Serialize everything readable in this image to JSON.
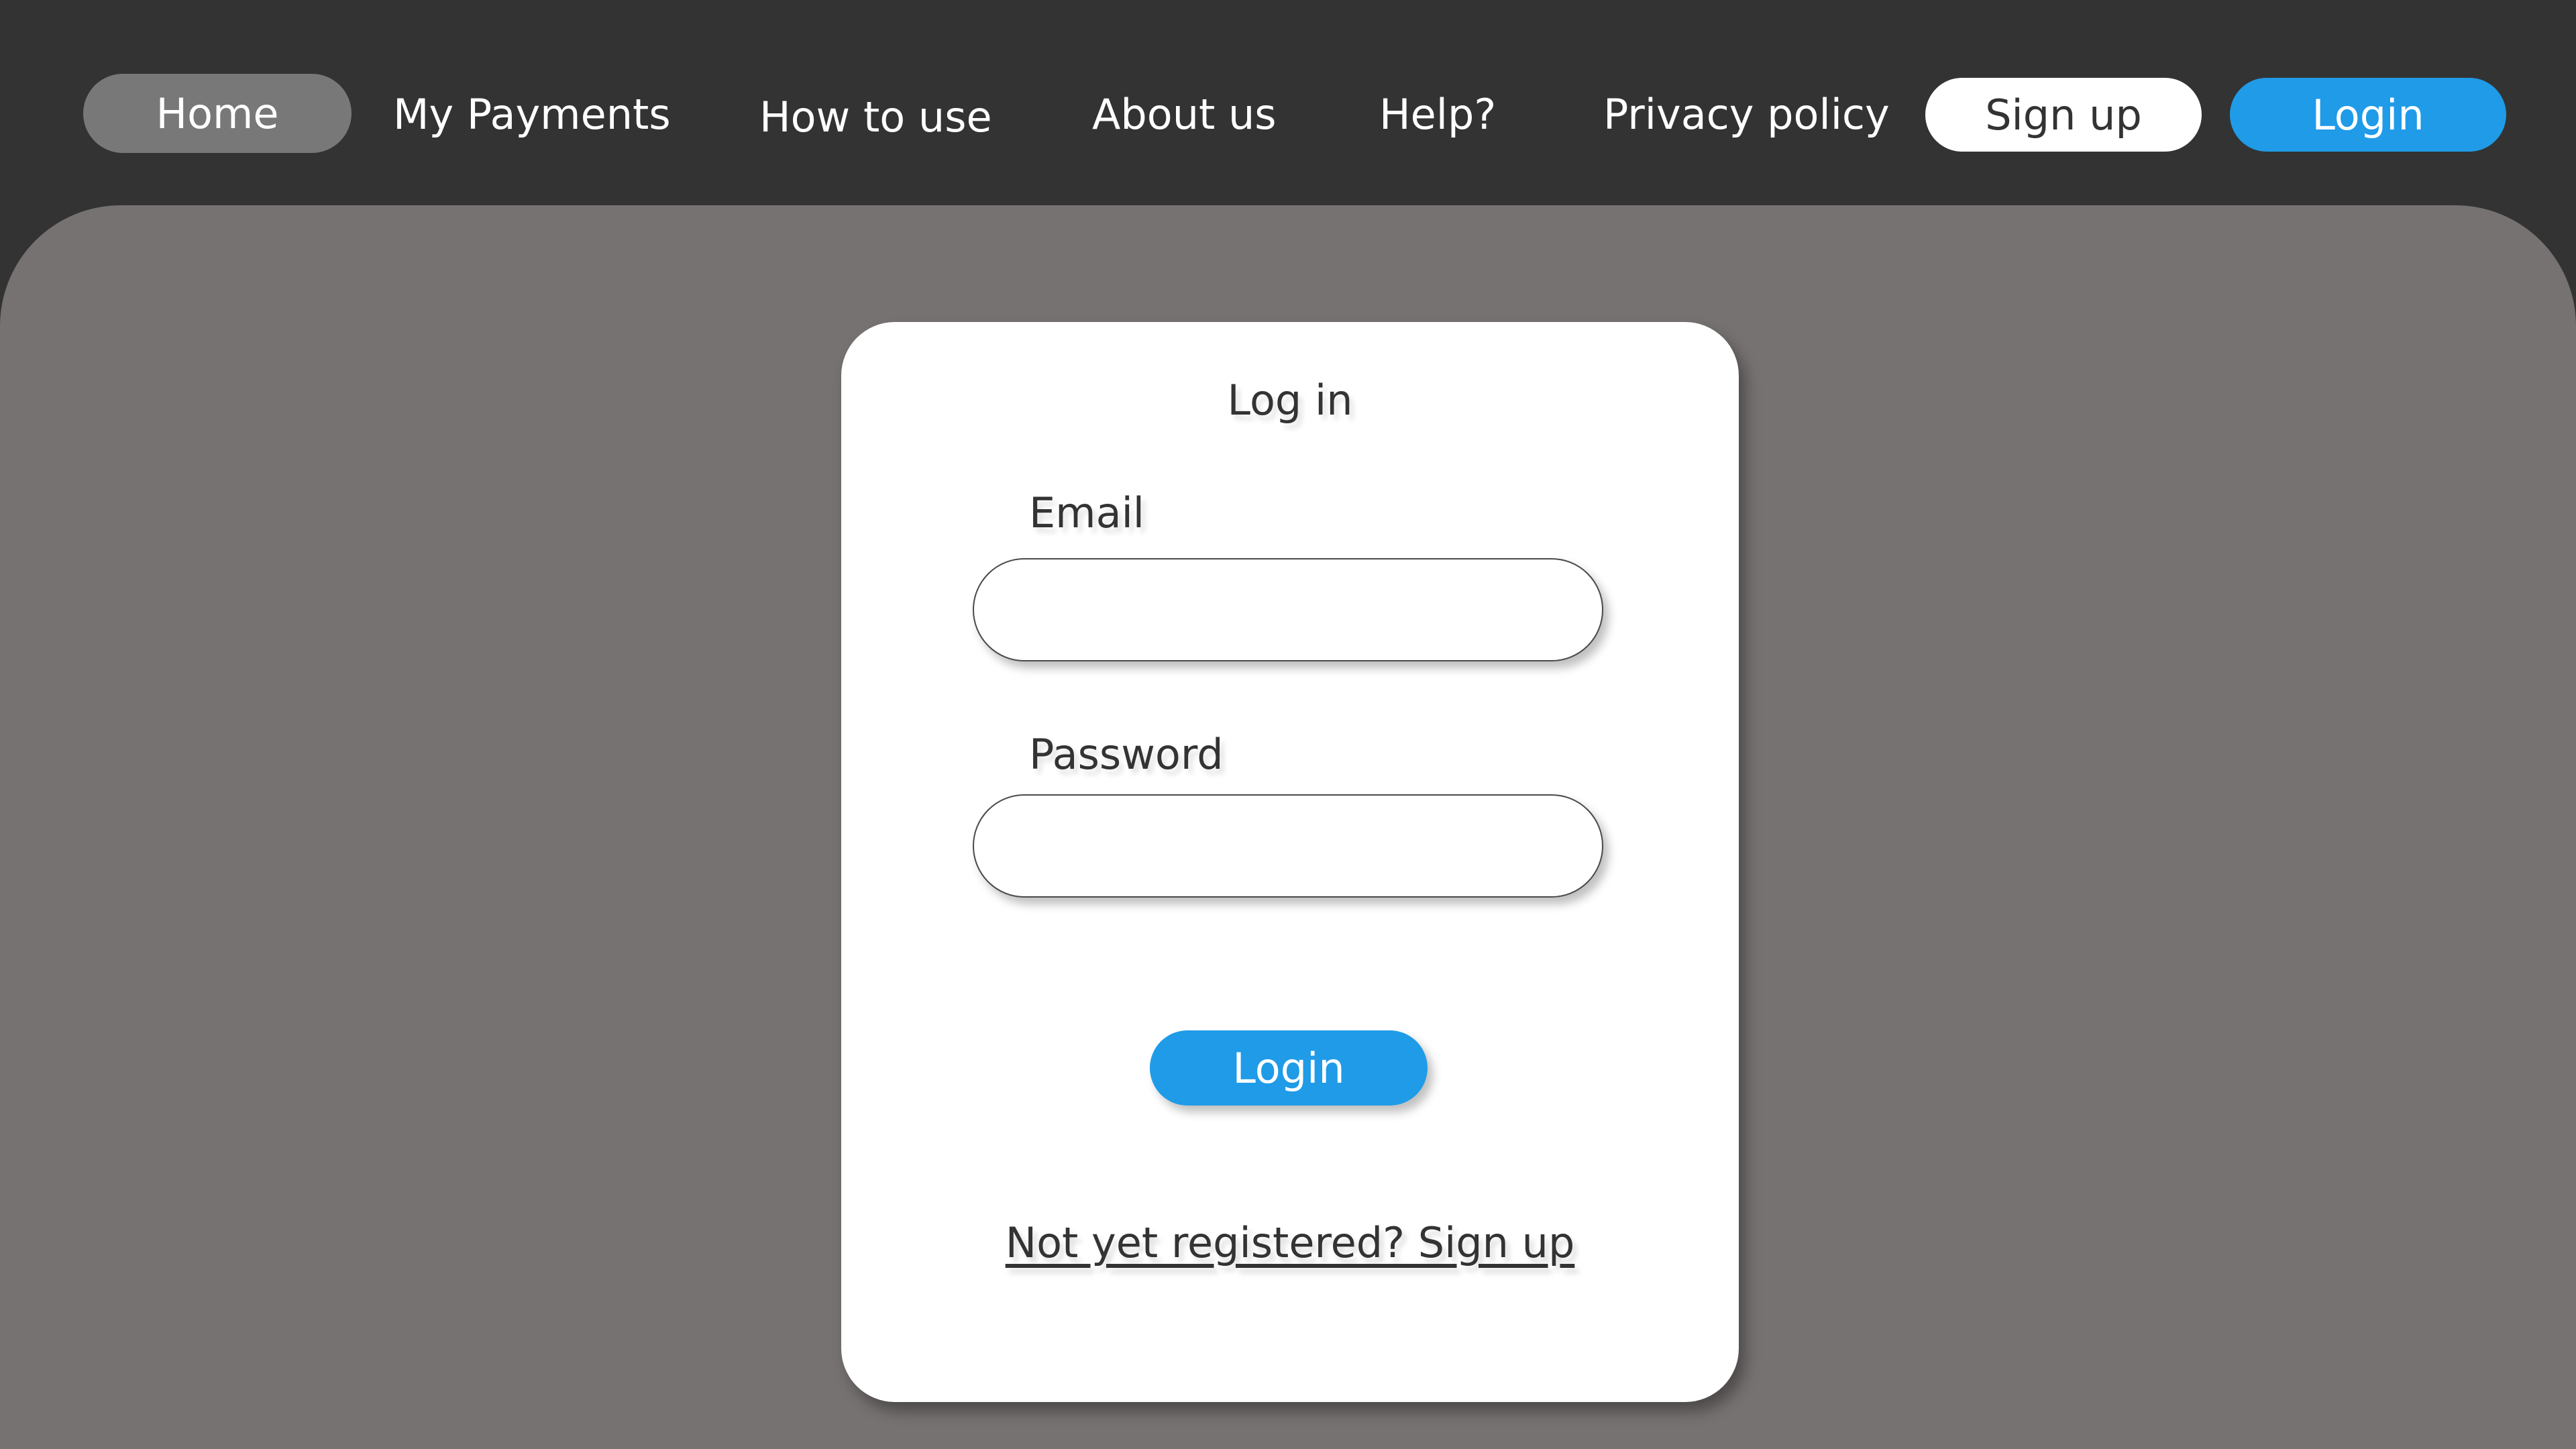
{
  "nav": {
    "home": "Home",
    "items": [
      {
        "label": "My Payments"
      },
      {
        "label": "How to use"
      },
      {
        "label": "About us"
      },
      {
        "label": "Help?"
      },
      {
        "label": "Privacy policy"
      }
    ],
    "signup_label": "Sign up",
    "login_label": "Login"
  },
  "login_card": {
    "title": "Log in",
    "email_label": "Email",
    "email_value": "",
    "password_label": "Password",
    "password_value": "",
    "submit_label": "Login",
    "signup_prompt": "Not yet registered? Sign up"
  },
  "colors": {
    "header_bg": "#333333",
    "main_bg": "#767271",
    "accent": "#1f9be8",
    "home_pill": "#787878"
  }
}
